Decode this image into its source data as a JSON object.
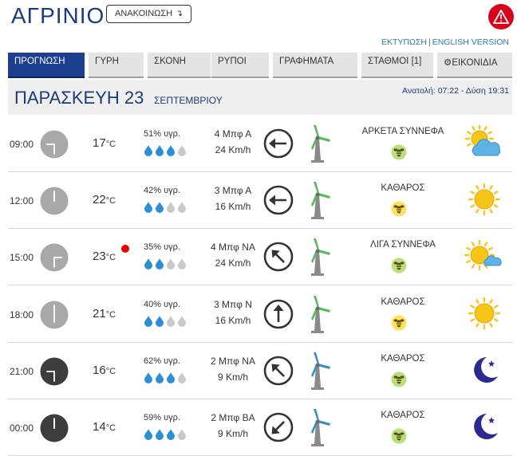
{
  "header": {
    "city": "ΑΓΡΙΝΙΟ",
    "announcement_label": "ΑΝΑΚΟΙΝΩΣΗ",
    "announcement_arrow": "↴",
    "alert_icon": "warning-triangle-icon"
  },
  "links": {
    "print": "ΕΚΤΥΠΩΣΗ",
    "separator": "|",
    "english": "ENGLISH VERSION"
  },
  "tabs": [
    {
      "label": "ΠΡΟΓΝΩΣΗ",
      "active": true
    },
    {
      "label": "ΓΥΡΗ",
      "active": false
    },
    {
      "label": "ΣΚΟΝΗ",
      "active": false
    },
    {
      "label": "ΡΥΠΟΙ",
      "active": false
    },
    {
      "label": "ΓΡΑΦΗΜΑΤΑ",
      "active": false
    },
    {
      "label": "ΣΤΑΘΜΟΙ [1]",
      "active": false
    },
    {
      "label": "ΕΙΚΟΝΙΔΙΑ",
      "active": false,
      "icon": "gear-icon"
    }
  ],
  "day": {
    "name": "ΠΑΡΑΣΚΕΥΗ 23",
    "month": "ΣΕΠΤΕΜΒΡΙΟΥ",
    "sun": "Ανατολή: 07:22 - Δύση 19:31"
  },
  "colors": {
    "brand_blue": "#1c3f8f",
    "alert_red": "#d9001b",
    "drop_blue": "#2b8fd6",
    "drop_grey": "#c9c9c9",
    "turbine_day": "#5cb85c",
    "turbine_night": "#3a8fc2",
    "bee_green": "#b7e07a",
    "bee_yellow": "#ffe05a"
  },
  "rows": [
    {
      "time": "09:00",
      "clock_style": "day",
      "temp": "17",
      "unit": "°C",
      "hot": false,
      "humidity": "51% υγρ.",
      "drops_filled": 3,
      "wind_bf": "4 Μπφ Α",
      "wind_kmh": "24 Km/h",
      "arrow_icon": "wind-direction-arrow-icon",
      "arrow_deg": 270,
      "turbine": "day",
      "condition": "ΑΡΚΕΤΑ ΣΥΝΝΕΦΑ",
      "bee": "green",
      "weather_icon": "partly-cloudy-icon"
    },
    {
      "time": "12:00",
      "clock_style": "day",
      "temp": "22",
      "unit": "°C",
      "hot": false,
      "humidity": "42% υγρ.",
      "drops_filled": 2,
      "wind_bf": "3 Μπφ Α",
      "wind_kmh": "16 Km/h",
      "arrow_icon": "wind-direction-arrow-icon",
      "arrow_deg": 270,
      "turbine": "day",
      "condition": "ΚΑΘΑΡΟΣ",
      "bee": "yellow",
      "weather_icon": "sun-icon"
    },
    {
      "time": "15:00",
      "clock_style": "day",
      "temp": "23",
      "unit": "°C",
      "hot": true,
      "humidity": "35% υγρ.",
      "drops_filled": 2,
      "wind_bf": "4 Μπφ ΝΑ",
      "wind_kmh": "24 Km/h",
      "arrow_icon": "wind-direction-arrow-icon",
      "arrow_deg": 315,
      "turbine": "day",
      "condition": "ΛΙΓΑ ΣΥΝΝΕΦΑ",
      "bee": "green",
      "weather_icon": "sun-cloud-icon"
    },
    {
      "time": "18:00",
      "clock_style": "day",
      "temp": "21",
      "unit": "°C",
      "hot": false,
      "humidity": "40% υγρ.",
      "drops_filled": 2,
      "wind_bf": "3 Μπφ Ν",
      "wind_kmh": "16 Km/h",
      "arrow_icon": "wind-direction-arrow-icon",
      "arrow_deg": 0,
      "turbine": "day",
      "condition": "ΚΑΘΑΡΟΣ",
      "bee": "yellow",
      "weather_icon": "sun-icon"
    },
    {
      "time": "21:00",
      "clock_style": "night",
      "temp": "16",
      "unit": "°C",
      "hot": false,
      "humidity": "62% υγρ.",
      "drops_filled": 3,
      "wind_bf": "2 Μπφ ΝΑ",
      "wind_kmh": "9 Km/h",
      "arrow_icon": "wind-direction-arrow-icon",
      "arrow_deg": 315,
      "turbine": "night",
      "condition": "ΚΑΘΑΡΟΣ",
      "bee": "green",
      "weather_icon": "moon-icon"
    },
    {
      "time": "00:00",
      "clock_style": "night",
      "temp": "14",
      "unit": "°C",
      "hot": false,
      "humidity": "59% υγρ.",
      "drops_filled": 3,
      "wind_bf": "2 Μπφ ΒΑ",
      "wind_kmh": "9 Km/h",
      "arrow_icon": "wind-direction-arrow-icon",
      "arrow_deg": 225,
      "turbine": "night",
      "condition": "ΚΑΘΑΡΟΣ",
      "bee": "green",
      "weather_icon": "moon-icon"
    }
  ]
}
